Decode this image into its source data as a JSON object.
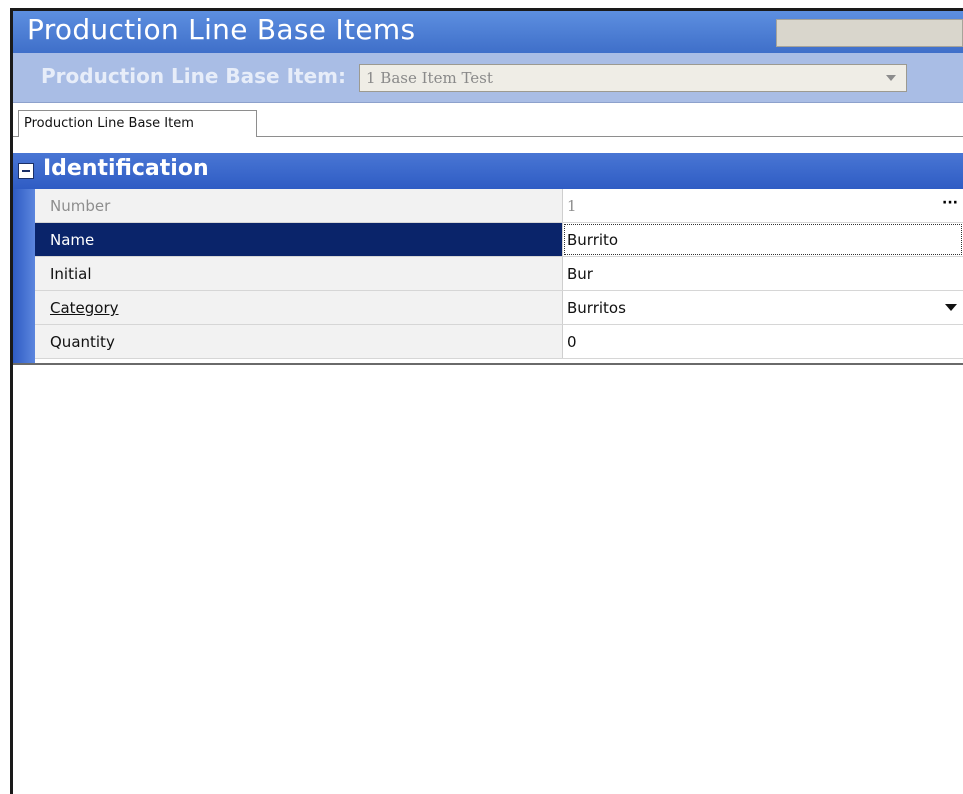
{
  "window": {
    "title": "Production Line Base Items"
  },
  "selector": {
    "label": "Production Line Base Item:",
    "value": "1 Base Item Test"
  },
  "tabs": [
    {
      "label": "Production Line Base Item"
    }
  ],
  "section": {
    "title": "Identification"
  },
  "rows": [
    {
      "label": "Number",
      "value": "1",
      "state": "disabled"
    },
    {
      "label": "Name",
      "value": "Burrito",
      "state": "selected"
    },
    {
      "label": "Initial",
      "value": "Bur",
      "state": "normal"
    },
    {
      "label": "Category",
      "value": "Burritos",
      "state": "link"
    },
    {
      "label": "Quantity",
      "value": "0",
      "state": "normal"
    }
  ],
  "icons": {
    "collapse": "minus-box-icon",
    "ellipsis": "ellipsis-icon",
    "dropdown": "chevron-down-icon"
  }
}
